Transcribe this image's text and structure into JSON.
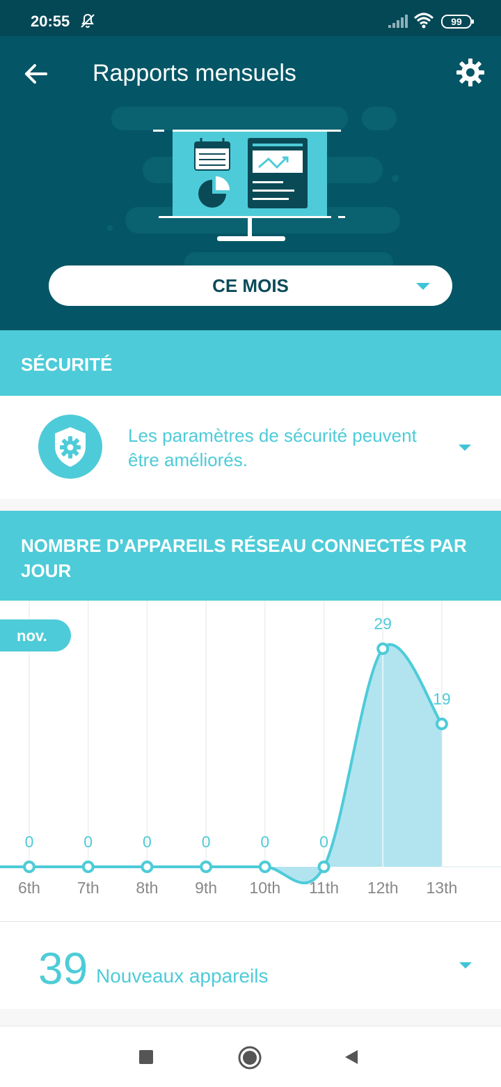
{
  "status_bar": {
    "time": "20:55",
    "battery": "99",
    "icons": [
      "notifications-off-icon",
      "signal-icon",
      "wifi-icon",
      "battery-icon"
    ]
  },
  "header": {
    "title": "Rapports mensuels",
    "back_icon": "arrow-left-icon",
    "settings_icon": "gear-icon"
  },
  "period_selector": {
    "value": "CE MOIS"
  },
  "security_section": {
    "title": "SÉCURITÉ",
    "message": "Les paramètres de sécurité peuvent être améliorés.",
    "icon": "shield-gear-icon"
  },
  "devices_section": {
    "title": "NOMBRE D'APPAREILS RÉSEAU CONNECTÉS PAR JOUR"
  },
  "chart_data": {
    "type": "area",
    "month_tag": "nov.",
    "categories": [
      "6th",
      "7th",
      "8th",
      "9th",
      "10th",
      "11th",
      "12th",
      "13th"
    ],
    "values": [
      0,
      0,
      0,
      0,
      0,
      0,
      29,
      19
    ],
    "ylim": [
      0,
      29
    ],
    "grid": "vertical",
    "colors": {
      "line": "#4ecbd8",
      "fill": "#aee3ef"
    }
  },
  "summary": {
    "count": "39",
    "label": "Nouveaux appareils"
  },
  "colors": {
    "header": "#045666",
    "status_bar": "#044856",
    "accent": "#4ecbd8"
  },
  "nav_bar": {
    "icons": [
      "recent-apps-icon",
      "home-icon",
      "back-icon"
    ]
  }
}
